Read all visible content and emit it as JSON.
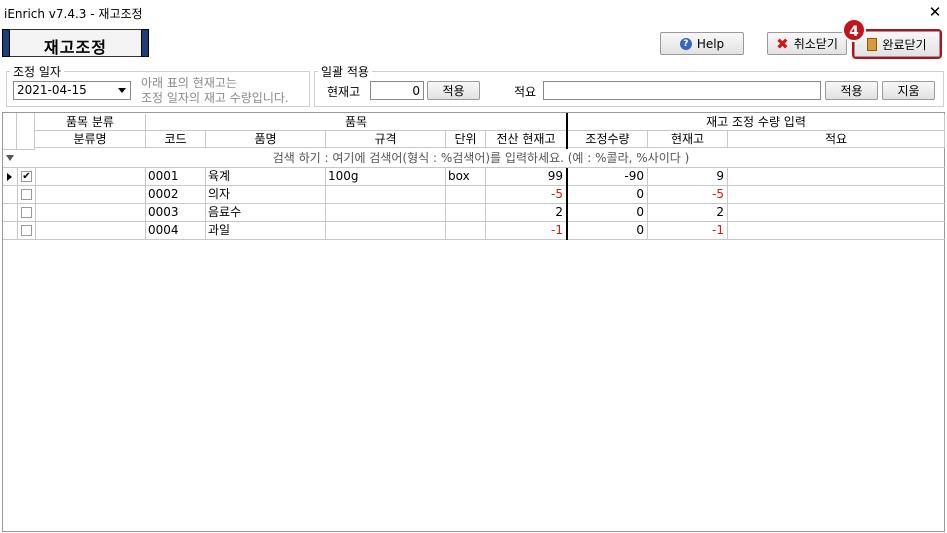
{
  "window": {
    "title": "iEnrich v7.4.3 - 재고조정"
  },
  "header": {
    "banner": "재고조정"
  },
  "toolbar": {
    "help": "Help",
    "cancel_close": "취소닫기",
    "done_close": "완료닫기",
    "step_badge": "4"
  },
  "date_section": {
    "title": "조정 일자",
    "date": "2021-04-15",
    "hint_line1": "아래 표의 현재고는",
    "hint_line2": "조정 일자의 재고 수량입니다."
  },
  "bulk_section": {
    "title": "일괄 적용",
    "stock_label": "현재고",
    "stock_value": "0",
    "apply1": "적용",
    "memo_label": "적요",
    "memo_value": "",
    "apply2": "적용",
    "erase": "지움"
  },
  "grid": {
    "group_headers": {
      "category": "품목 분류",
      "item": "품목",
      "input": "재고 조정 수량 입력"
    },
    "columns": [
      "분류명",
      "코드",
      "품명",
      "규격",
      "단위",
      "전산 현재고",
      "조정수량",
      "현재고",
      "적요"
    ],
    "search_hint": "검색 하기 : 여기에 검색어(형식 : %검색어)를 입력하세요. (예 : %콜라, %사이다 )",
    "rows": [
      {
        "checked": true,
        "category": "",
        "code": "0001",
        "name": "육계",
        "spec": "100g",
        "unit": "box",
        "system_stock": "99",
        "adjust": "-90",
        "current": "9",
        "memo": ""
      },
      {
        "checked": false,
        "category": "",
        "code": "0002",
        "name": "의자",
        "spec": "",
        "unit": "",
        "system_stock": "-5",
        "adjust": "0",
        "current": "-5",
        "memo": ""
      },
      {
        "checked": false,
        "category": "",
        "code": "0003",
        "name": "음료수",
        "spec": "",
        "unit": "",
        "system_stock": "2",
        "adjust": "0",
        "current": "2",
        "memo": ""
      },
      {
        "checked": false,
        "category": "",
        "code": "0004",
        "name": "과일",
        "spec": "",
        "unit": "",
        "system_stock": "-1",
        "adjust": "0",
        "current": "-1",
        "memo": ""
      }
    ]
  },
  "colors": {
    "negative": "#d01818",
    "banner_bar": "#1c3f7a",
    "highlight": "#b01020"
  }
}
